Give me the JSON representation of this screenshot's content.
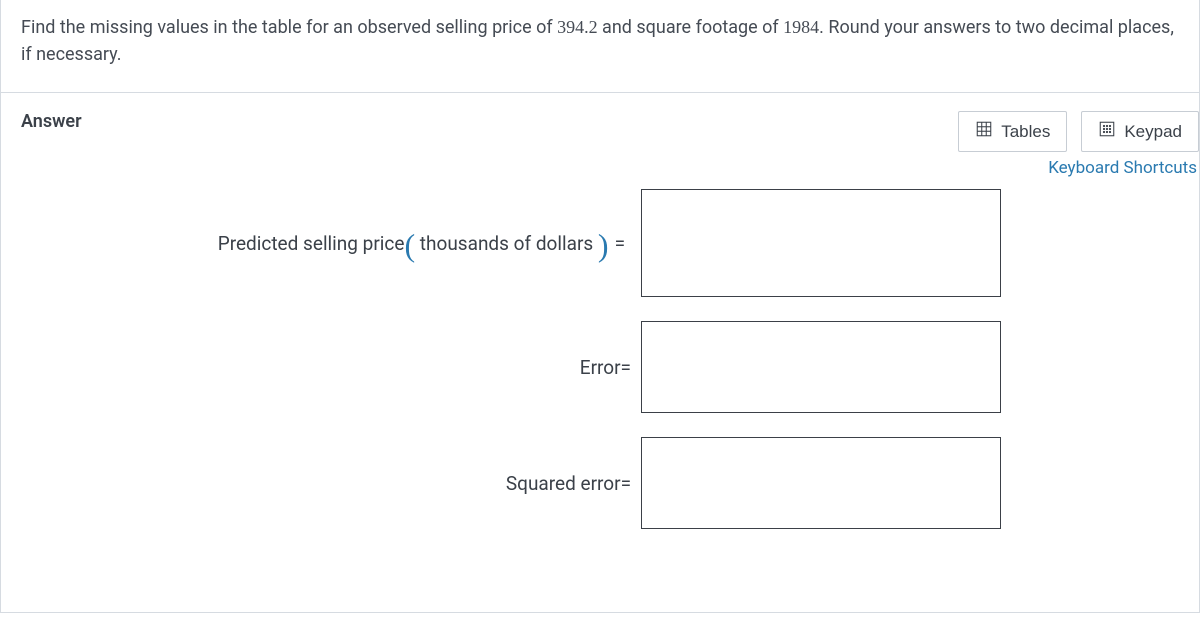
{
  "question": {
    "prefix": "Find the missing values in the table for an observed selling price of ",
    "price": "394.2",
    "mid": " and square footage of ",
    "sqft": "1984",
    "suffix": ". Round your answers to two decimal places, if necessary."
  },
  "answer_label": "Answer",
  "toolbar": {
    "tables": "Tables",
    "keypad": "Keypad",
    "shortcuts": "Keyboard Shortcuts"
  },
  "rows": {
    "predicted": {
      "pre": "Predicted selling price",
      "paren_inner": " thousands of dollars ",
      "eq": "="
    },
    "error": {
      "label": "Error="
    },
    "squared": {
      "label": "Squared error="
    }
  }
}
